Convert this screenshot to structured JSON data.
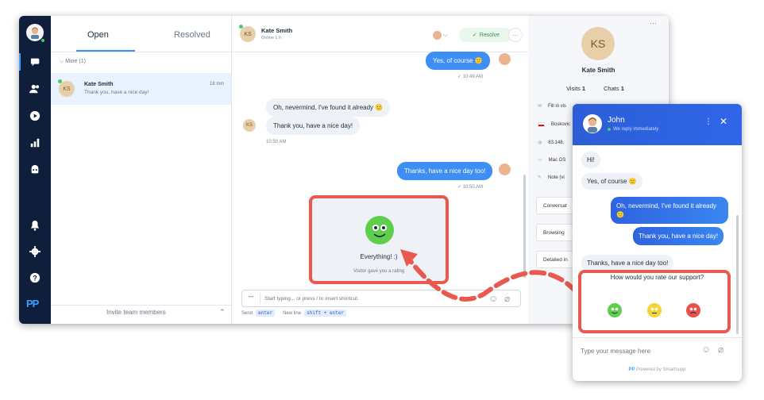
{
  "list": {
    "tab_open": "Open",
    "tab_resolved": "Resolved",
    "section": "Mine (1)",
    "conversation": {
      "initials": "KS",
      "name": "Kate Smith",
      "time": "18 min",
      "preview": "Thank you, have a nice day!"
    },
    "invite": "Invite team members"
  },
  "chat_header": {
    "initials": "KS",
    "name": "Kate Smith",
    "status": "Online 1 h",
    "resolve_label": "Resolve"
  },
  "messages": {
    "m1": "Yes, of course 🙂",
    "t1": "✓ 10:49 AM",
    "m2": "Oh, nevermind, I've found it already 🙂",
    "m3": "Thank you, have a nice day!",
    "t2": "10:50 AM",
    "m4": "Thanks, have a nice day too!",
    "t3": "✓ 10:50 AM",
    "rating_title": "Everything! :)",
    "rating_sub": "Visitor gave you a rating"
  },
  "composer": {
    "placeholder": "Start typing... or press / to insert shortcut.",
    "send_label": "Send",
    "send_key": "enter",
    "newline_label": "New line",
    "newline_key": "shift + enter"
  },
  "info_panel": {
    "initials": "KS",
    "name": "Kate Smith",
    "visits_label": "Visits",
    "visits": "1",
    "chats_label": "Chats",
    "chats": "1",
    "rows": [
      "Fill in vis",
      "Boskovic",
      "83.148.",
      "Mac OS",
      "Note (vi"
    ],
    "boxes": [
      "Conversat",
      "Browsing",
      "Detailed in"
    ]
  },
  "widget": {
    "agent": "John",
    "status": "We reply immediately",
    "w1": "Hi!",
    "w2": "Yes, of course 🙂",
    "w3": "Oh, nevermind, I've found it already 🙂",
    "w4": "Thank you, have a nice day!",
    "w5": "Thanks, have a nice day too!",
    "rate_question": "How would you rate our support?",
    "input_placeholder": "Type your message here",
    "powered": "Powered by Smartsupp"
  }
}
